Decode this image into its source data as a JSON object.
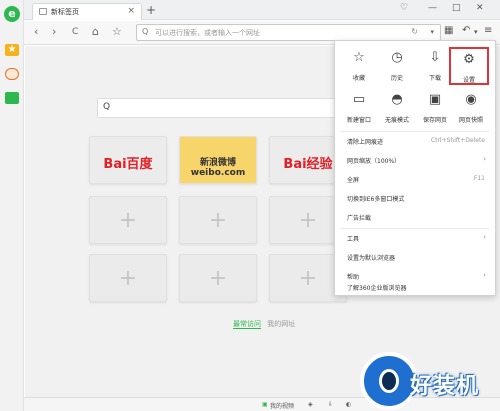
{
  "tab": {
    "title": "新标签页",
    "close": "×"
  },
  "new_tab": "+",
  "window_controls": {
    "skin": "♡",
    "min": "—",
    "max": "□",
    "close": "✕"
  },
  "nav": {
    "back": "‹",
    "forward": "›",
    "reload": "C",
    "home": "⌂",
    "favorite": "☆"
  },
  "address": {
    "placeholder": "可以进行搜索，或者输入一个网址",
    "search": "Q",
    "go": "↻",
    "chevron": "▾"
  },
  "toolbar_right": {
    "apps": "▦",
    "undo": "↶",
    "undo_chev": "▾",
    "menu": "≡"
  },
  "sidebar": {
    "logo": "e",
    "favorites": "★"
  },
  "search_icon": "Q",
  "tiles": [
    {
      "kind": "baidu",
      "label": "Bai百度"
    },
    {
      "kind": "weibo",
      "label": "新浪微博 weibo.com"
    },
    {
      "kind": "baidu",
      "label": "Bai经验"
    },
    {
      "kind": "empty",
      "label": "+"
    },
    {
      "kind": "empty",
      "label": "+"
    },
    {
      "kind": "empty",
      "label": "+"
    },
    {
      "kind": "empty",
      "label": "+"
    },
    {
      "kind": "empty",
      "label": "+"
    },
    {
      "kind": "empty",
      "label": "+"
    },
    {
      "kind": "empty",
      "label": "+"
    }
  ],
  "bottom_tabs": {
    "active": "最常访问",
    "inactive": "我的网址"
  },
  "menu": {
    "grid": [
      {
        "icon": "☆",
        "label": "收藏"
      },
      {
        "icon": "◷",
        "label": "历史"
      },
      {
        "icon": "⇩",
        "label": "下载"
      },
      {
        "icon": "⚙",
        "label": "设置"
      },
      {
        "icon": "▭",
        "label": "新建窗口"
      },
      {
        "icon": "◓",
        "label": "无痕模式"
      },
      {
        "icon": "▣",
        "label": "保存网页"
      },
      {
        "icon": "◉",
        "label": "网页快照"
      }
    ],
    "items": [
      {
        "label": "清除上网痕迹",
        "shortcut": "Ctrl+Shift+Delete",
        "arrow": ""
      },
      {
        "label": "网页缩放（100%）",
        "shortcut": "",
        "arrow": "›"
      },
      {
        "label": "全屏",
        "shortcut": "F11",
        "arrow": ""
      },
      {
        "label": "切换到IE6多窗口模式",
        "shortcut": "",
        "arrow": ""
      },
      {
        "label": "广告拦截",
        "shortcut": "",
        "arrow": ""
      },
      {
        "label": "工具",
        "shortcut": "",
        "arrow": "›"
      },
      {
        "label": "设置为默认浏览器",
        "shortcut": "",
        "arrow": ""
      },
      {
        "label": "帮助",
        "shortcut": "",
        "arrow": "›"
      },
      {
        "label": "了解360企业版浏览器",
        "shortcut": "",
        "arrow": ""
      }
    ]
  },
  "status": {
    "video": "我的视频"
  },
  "watermark": {
    "text": "好装机"
  },
  "colors": {
    "accent": "#2db84d",
    "highlight": "#e0323a",
    "weibo": "#f8d56a",
    "baidu_red": "#e31e25"
  }
}
